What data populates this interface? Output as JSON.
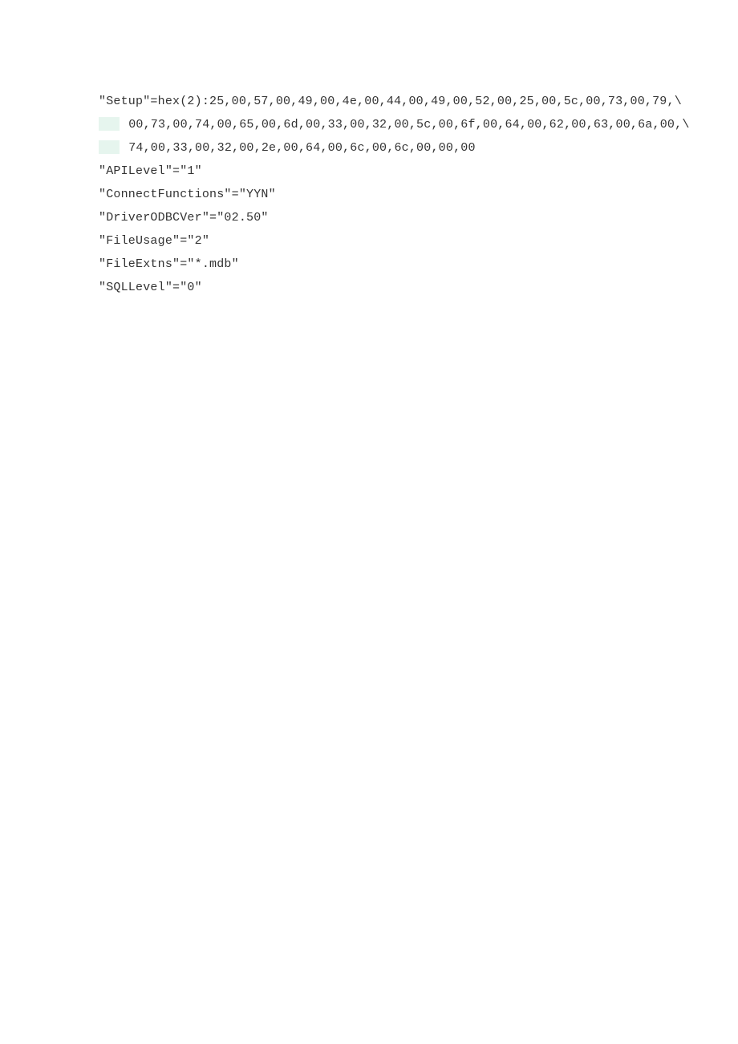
{
  "lines": {
    "l1": "\"Setup\"=hex(2):25,00,57,00,49,00,4e,00,44,00,49,00,52,00,25,00,5c,00,73,00,79,\\",
    "l2_text": "00,73,00,74,00,65,00,6d,00,33,00,32,00,5c,00,6f,00,64,00,62,00,63,00,6a,00,\\",
    "l3_text": "74,00,33,00,32,00,2e,00,64,00,6c,00,6c,00,00,00",
    "l4": "\"APILevel\"=\"1\"",
    "l5": "\"ConnectFunctions\"=\"YYN\"",
    "l6": "\"DriverODBCVer\"=\"02.50\"",
    "l7": "\"FileUsage\"=\"2\"",
    "l8": "\"FileExtns\"=\"*.mdb\"",
    "l9": "\"SQLLevel\"=\"0\""
  }
}
